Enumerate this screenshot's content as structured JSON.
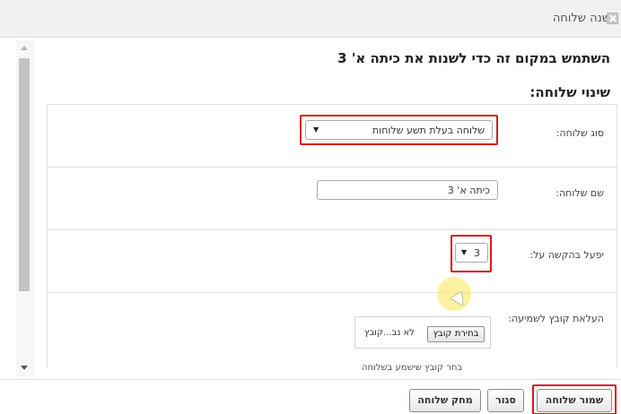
{
  "window": {
    "title": "שנה שלוחה"
  },
  "page": {
    "heading": "השתמש במקום זה כדי לשנות את כיתה א' 3",
    "subheading": "שינוי שלוחה:"
  },
  "form": {
    "type_label": "סוג שלוחה:",
    "type_value": "שלוחה בעלת תשע שלוחות",
    "name_label": "שם שלוחה:",
    "name_value": "כיתה א' 3",
    "activate_label": "יפעל בהקשה על:",
    "activate_value": "3",
    "upload_label": "העלאת קובץ לשמיעה:",
    "choose_file_label": "בחירת קובץ",
    "no_file_text": "לא נב...קובץ",
    "upload_help": "בחר קובץ שישמע בשלוחה"
  },
  "footer": {
    "save_label": "שמור שלוחה",
    "close_label": "סגור",
    "delete_label": "מחק שלוחה"
  },
  "colors": {
    "highlight": "#d71920",
    "cursor_halo": "#f8e46b"
  },
  "icons": [
    "close-icon",
    "scroll-up-icon",
    "scroll-down-icon",
    "dropdown-arrow-icon",
    "mouse-cursor-icon"
  ]
}
